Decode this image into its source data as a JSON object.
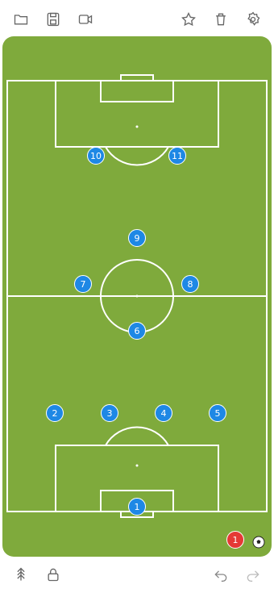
{
  "toolbar_top": {
    "icons": [
      "folder-icon",
      "save-icon",
      "video-icon",
      "star-icon",
      "trash-icon",
      "settings-icon"
    ]
  },
  "toolbar_bottom": {
    "icons": [
      "formation-icon",
      "lock-icon",
      "undo-icon",
      "redo-icon"
    ]
  },
  "colors": {
    "pitch": "#7faa3c",
    "lines": "#ffffff",
    "team": "#1e88e5",
    "opponent": "#e53935"
  },
  "team_players": [
    "1",
    "2",
    "3",
    "4",
    "5",
    "6",
    "7",
    "8",
    "9",
    "10",
    "11"
  ],
  "opponent_players": [
    "1"
  ]
}
